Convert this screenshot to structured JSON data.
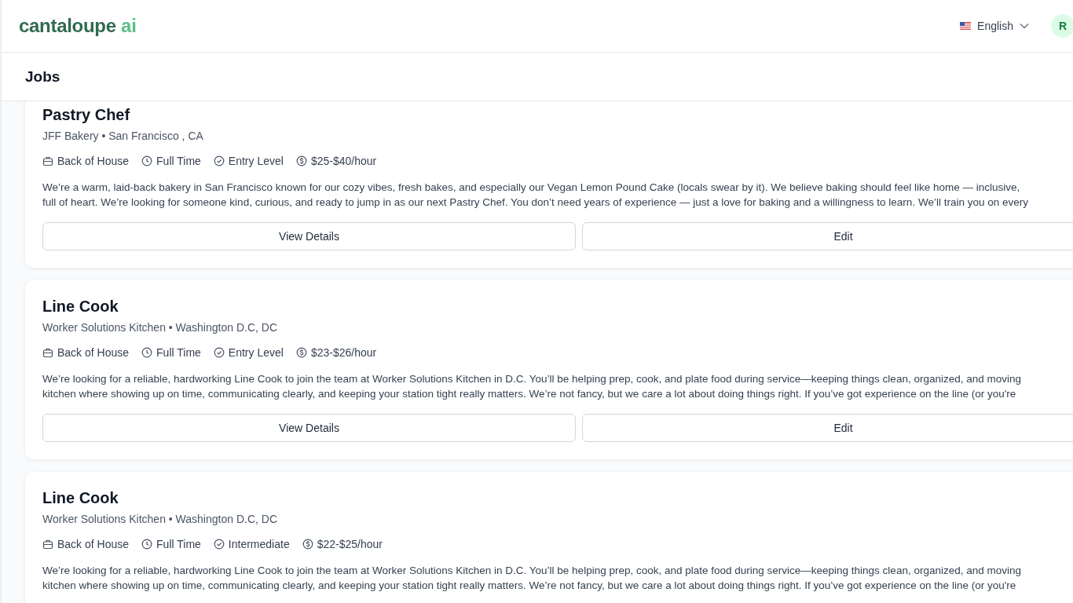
{
  "header": {
    "logo": {
      "main": "cantaloupe",
      "accent": "ai"
    },
    "language": "English",
    "avatar_initial": "R"
  },
  "page_title": "Jobs",
  "jobs": [
    {
      "title": "Pastry Chef",
      "company_location": "JFF Bakery • San Francisco , CA",
      "tags": [
        {
          "kind": "department",
          "text": "Back of House"
        },
        {
          "kind": "schedule",
          "text": "Full Time"
        },
        {
          "kind": "level",
          "text": "Entry Level"
        },
        {
          "kind": "pay",
          "text": "$25-$40/hour"
        }
      ],
      "description_lines": [
        "We’re a warm, laid-back bakery in San Francisco known for our cozy vibes, fresh bakes, and especially our Vegan Lemon Pound Cake (locals swear by it). We believe baking should feel like home — inclusive,",
        "full of heart. We’re looking for someone kind, curious, and ready to jump in as our next Pastry Chef. You don’t need years of experience — just a love for baking and a willingness to learn. We’ll train you on every"
      ],
      "buttons": [
        "View Details",
        "Edit"
      ]
    },
    {
      "title": "Line Cook",
      "company_location": "Worker Solutions Kitchen • Washington D.C, DC",
      "tags": [
        {
          "kind": "department",
          "text": "Back of House"
        },
        {
          "kind": "schedule",
          "text": "Full Time"
        },
        {
          "kind": "level",
          "text": "Entry Level"
        },
        {
          "kind": "pay",
          "text": "$23-$26/hour"
        }
      ],
      "description_lines": [
        "We’re looking for a reliable, hardworking Line Cook to join the team at Worker Solutions Kitchen in D.C. You’ll be helping prep, cook, and plate food during service—keeping things clean, organized, and moving",
        "kitchen where showing up on time, communicating clearly, and keeping your station tight really matters. We’re not fancy, but we care a lot about doing things right. If you’ve got experience on the line (or you're"
      ],
      "buttons": [
        "View Details",
        "Edit"
      ]
    },
    {
      "title": "Line Cook",
      "company_location": "Worker Solutions Kitchen • Washington D.C, DC",
      "tags": [
        {
          "kind": "department",
          "text": "Back of House"
        },
        {
          "kind": "schedule",
          "text": "Full Time"
        },
        {
          "kind": "level",
          "text": "Intermediate"
        },
        {
          "kind": "pay",
          "text": "$22-$25/hour"
        }
      ],
      "description_lines": [
        "We’re looking for a reliable, hardworking Line Cook to join the team at Worker Solutions Kitchen in D.C. You’ll be helping prep, cook, and plate food during service—keeping things clean, organized, and moving",
        "kitchen where showing up on time, communicating clearly, and keeping your station tight really matters. We’re not fancy, but we care a lot about doing things right. If you’ve got experience on the line (or you're"
      ]
    }
  ]
}
